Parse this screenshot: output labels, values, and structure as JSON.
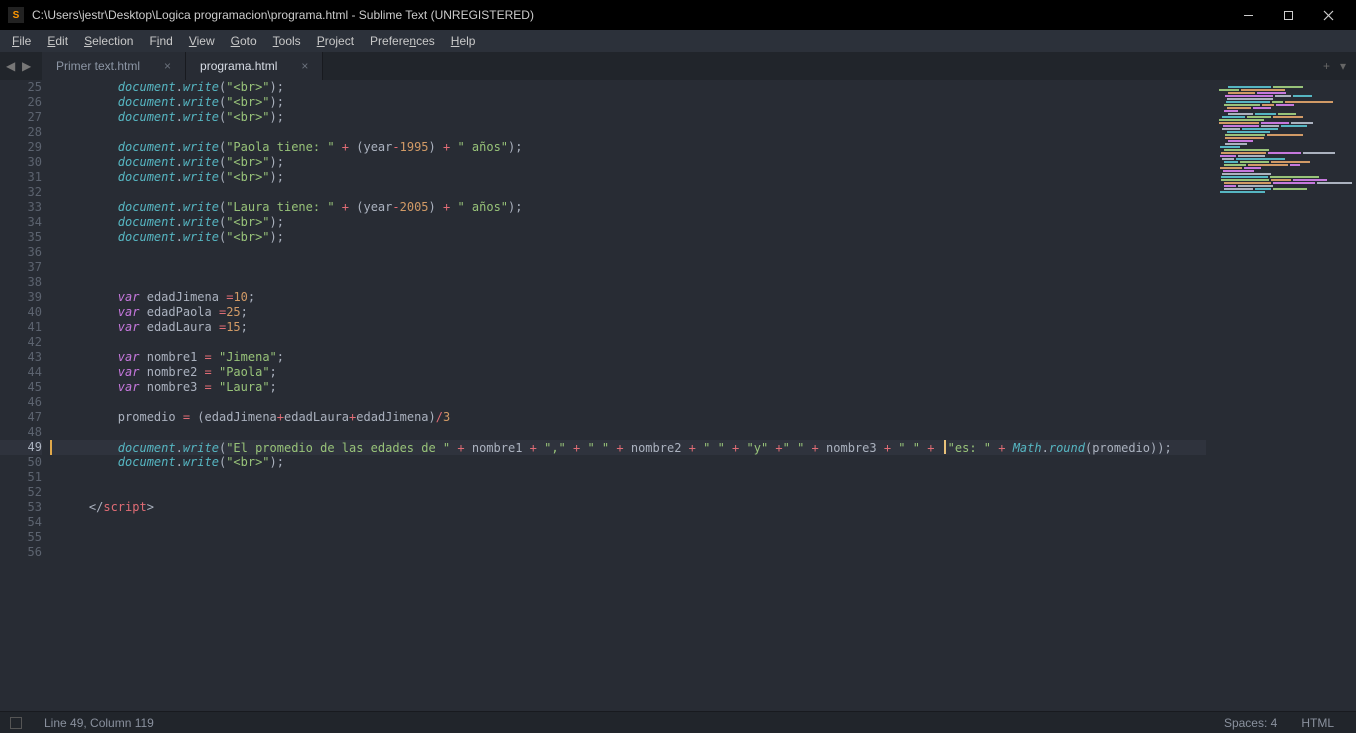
{
  "titlebar": {
    "logo": "S",
    "title": "C:\\Users\\jestr\\Desktop\\Logica programacion\\programa.html - Sublime Text (UNREGISTERED)"
  },
  "menu": {
    "file": "File",
    "edit": "Edit",
    "selection": "Selection",
    "find": "Find",
    "view": "View",
    "goto": "Goto",
    "tools": "Tools",
    "project": "Project",
    "preferences": "Preferences",
    "help": "Help"
  },
  "tabs": [
    {
      "label": "Primer text.html",
      "active": false
    },
    {
      "label": "programa.html",
      "active": true
    }
  ],
  "tabend": {
    "plus": "+",
    "down": "▾"
  },
  "lines": {
    "start": 25,
    "end": 56,
    "highlight": 49
  },
  "code": {
    "l25": {
      "obj": "document",
      "dot": ".",
      "fn": "write",
      "open": "(",
      "str": "\"<br>\"",
      "close": ")",
      "semi": ";"
    },
    "l26": {
      "obj": "document",
      "dot": ".",
      "fn": "write",
      "open": "(",
      "str": "\"<br>\"",
      "close": ")",
      "semi": ";"
    },
    "l27": {
      "obj": "document",
      "dot": ".",
      "fn": "write",
      "open": "(",
      "str": "\"<br>\"",
      "close": ")",
      "semi": ";"
    },
    "l28": "",
    "l29": {
      "obj": "document",
      "dot": ".",
      "fn": "write",
      "open": "(",
      "str1": "\"Paola tiene: \"",
      "plus1": " + ",
      "po": "(",
      "v1": "year",
      "minus": "-",
      "n": "1995",
      "pc": ")",
      "plus2": " + ",
      "str2": "\" años\"",
      "close": ")",
      "semi": ";"
    },
    "l30": {
      "obj": "document",
      "dot": ".",
      "fn": "write",
      "open": "(",
      "str": "\"<br>\"",
      "close": ")",
      "semi": ";"
    },
    "l31": {
      "obj": "document",
      "dot": ".",
      "fn": "write",
      "open": "(",
      "str": "\"<br>\"",
      "close": ")",
      "semi": ";"
    },
    "l32": "",
    "l33": {
      "obj": "document",
      "dot": ".",
      "fn": "write",
      "open": "(",
      "str1": "\"Laura tiene: \"",
      "plus1": " + ",
      "po": "(",
      "v1": "year",
      "minus": "-",
      "n": "2005",
      "pc": ")",
      "plus2": " + ",
      "str2": "\" años\"",
      "close": ")",
      "semi": ";"
    },
    "l34": {
      "obj": "document",
      "dot": ".",
      "fn": "write",
      "open": "(",
      "str": "\"<br>\"",
      "close": ")",
      "semi": ";"
    },
    "l35": {
      "obj": "document",
      "dot": ".",
      "fn": "write",
      "open": "(",
      "str": "\"<br>\"",
      "close": ")",
      "semi": ";"
    },
    "l36": "",
    "l37": "",
    "l38": "",
    "l39": {
      "kw": "var",
      "sp": " ",
      "nm": "edadJimena ",
      "eq": "=",
      "num": "10",
      "semi": ";"
    },
    "l40": {
      "kw": "var",
      "sp": " ",
      "nm": "edadPaola ",
      "eq": "=",
      "num": "25",
      "semi": ";"
    },
    "l41": {
      "kw": "var",
      "sp": " ",
      "nm": "edadLaura ",
      "eq": "=",
      "num": "15",
      "semi": ";"
    },
    "l42": "",
    "l43": {
      "kw": "var",
      "sp": " ",
      "nm": "nombre1 ",
      "eq": "= ",
      "str": "\"Jimena\"",
      "semi": ";"
    },
    "l44": {
      "kw": "var",
      "sp": " ",
      "nm": "nombre2 ",
      "eq": "= ",
      "str": "\"Paola\"",
      "semi": ";"
    },
    "l45": {
      "kw": "var",
      "sp": " ",
      "nm": "nombre3 ",
      "eq": "= ",
      "str": "\"Laura\"",
      "semi": ";"
    },
    "l46": "",
    "l47": {
      "lhs": "promedio ",
      "eq": "= ",
      "po": "(",
      "a": "edadJimena",
      "p1": "+",
      "b": "edadLaura",
      "p2": "+",
      "c": "edadJimena",
      "pc": ")",
      "div": "/",
      "n": "3"
    },
    "l48": "",
    "l49": {
      "obj": "document",
      "dot": ".",
      "fn": "write",
      "open": "(",
      "s1": "\"El promedio de las edades de \"",
      "p1": " + ",
      "v1": "nombre1",
      "p2": " + ",
      "s2": "\",\"",
      "p3": " + ",
      "s3": "\" \"",
      "p4": " + ",
      "v2": "nombre2",
      "p5": " + ",
      "s4": "\" \"",
      "p6": " + ",
      "s5": "\"y\"",
      "p7": " +",
      "s6": "\" \"",
      "p8": " + ",
      "v3": "nombre3",
      "p9": " + ",
      "s7": "\" \"",
      "p10": " + ",
      "s8": "\"es: \"",
      "p11": " + ",
      "math": "Math",
      "dot2": ".",
      "round": "round",
      "po": "(",
      "prom": "promedio",
      "pc": "))",
      "semi": ";"
    },
    "l50": {
      "obj": "document",
      "dot": ".",
      "fn": "write",
      "open": "(",
      "str": "\"<br>\"",
      "close": ")",
      "semi": ";"
    },
    "l51": "",
    "l52": "",
    "l53": {
      "open": "</",
      "tag": "script",
      "close": ">"
    },
    "l54": "",
    "l55": "",
    "l56": ""
  },
  "status": {
    "pos": "Line 49, Column 119",
    "spaces": "Spaces: 4",
    "syntax": "HTML"
  }
}
